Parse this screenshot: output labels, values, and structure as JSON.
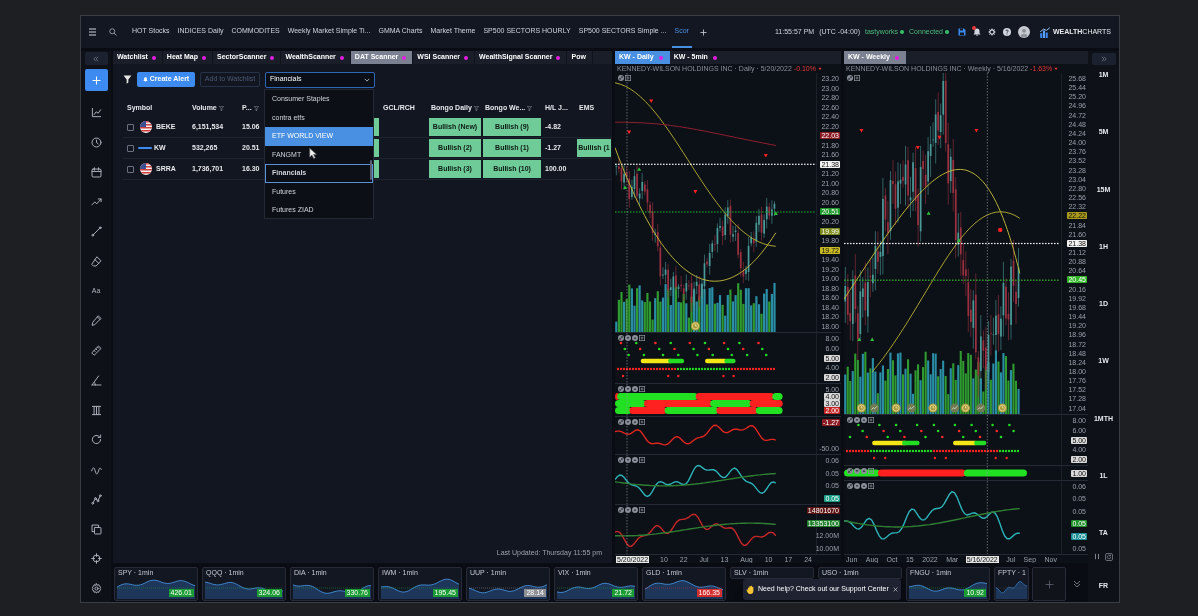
{
  "top_bar": {
    "tabs": [
      {
        "label": "HOT Stocks",
        "selected": false
      },
      {
        "label": "INDICES Daily",
        "selected": false
      },
      {
        "label": "COMMODITES",
        "selected": false
      },
      {
        "label": "Weekly Market Simple Ti...",
        "selected": false
      },
      {
        "label": "GMMA Charts",
        "selected": false
      },
      {
        "label": "Market Theme",
        "selected": false
      },
      {
        "label": "SP500 SECTORS HOURLY",
        "selected": false
      },
      {
        "label": "SP500 SECTORS Simple ...",
        "selected": false
      },
      {
        "label": "Scor",
        "selected": true
      }
    ],
    "time": "11:55:57 PM",
    "timezone": "(UTC -04:00)",
    "statuses": [
      {
        "label": "tastyworks",
        "color": "#35c46a"
      },
      {
        "label": "Connected",
        "color": "#35c46a"
      }
    ],
    "has_notifications": true,
    "logo": "**WEALTH**CHARTS"
  },
  "left_toolbar": {
    "text_tool": "Aa"
  },
  "scanner": {
    "tabs": [
      {
        "label": "Watchlist",
        "linked": true,
        "selected": false
      },
      {
        "label": "Heat Map",
        "linked": true,
        "selected": false
      },
      {
        "label": "SectorScanner",
        "linked": true,
        "selected": false
      },
      {
        "label": "WealthScanner",
        "linked": true,
        "selected": false
      },
      {
        "label": "DAT Scanner",
        "linked": true,
        "selected": true
      },
      {
        "label": "WSI Scanner",
        "linked": true,
        "selected": false
      },
      {
        "label": "WealthSignal Scanner",
        "linked": true,
        "selected": false
      },
      {
        "label": "Pow",
        "linked": false,
        "selected": false
      }
    ],
    "create_alert": "Create Alert",
    "add_to_watchlist": {
      "label": "Add to Watchlist",
      "disabled": true
    },
    "list_select": {
      "value": "Financials",
      "expanded": true,
      "options": [
        {
          "label": "Consumer Staples",
          "selected": false,
          "highlighted": false
        },
        {
          "label": "contra etfs",
          "selected": false,
          "highlighted": false
        },
        {
          "label": "ETF WORLD VIEW",
          "selected": false,
          "highlighted": true
        },
        {
          "label": "FANGMT",
          "selected": false,
          "highlighted": false
        },
        {
          "label": "Financials",
          "selected": true,
          "highlighted": false
        },
        {
          "label": "Futures",
          "selected": false,
          "highlighted": false
        },
        {
          "label": "Futures ZIAD",
          "selected": false,
          "highlighted": false
        }
      ]
    },
    "columns": [
      {
        "label": "Symbol",
        "filter": false
      },
      {
        "label": "Volume",
        "filter": true
      },
      {
        "label": "P...",
        "filter": true
      },
      {
        "label": "GCL/RCH",
        "filter": false
      },
      {
        "label": "Bongo Daily",
        "filter": true
      },
      {
        "label": "Bongo We...",
        "filter": true
      },
      {
        "label": "H/L J...",
        "filter": false
      },
      {
        "label": "EMS",
        "filter": false
      }
    ],
    "rows": [
      {
        "kind": "flag",
        "checked": false,
        "column_4": {
          "color": "#6fcb98"
        },
        "cells": [
          {
            "text": "BEKE"
          },
          {
            "text": "6,151,534"
          },
          {
            "text": "15.06"
          },
          null,
          {
            "text": "Bullish (New)",
            "color": "#6fcb98"
          },
          {
            "text": "Bullish (9)",
            "color": "#6fcb98"
          },
          {
            "text": "-4.82"
          },
          null
        ]
      },
      {
        "kind": "logo",
        "checked": false,
        "column_4": {
          "color": "#6fcb98"
        },
        "cells": [
          {
            "text": "KW"
          },
          {
            "text": "532,265"
          },
          {
            "text": "20.51"
          },
          null,
          {
            "text": "Bullish (2)",
            "color": "#6fcb98"
          },
          {
            "text": "Bullish (1)",
            "color": "#6fcb98"
          },
          {
            "text": "-1.27"
          },
          {
            "text": "Bullish (1",
            "color": "#6fcb98"
          }
        ]
      },
      {
        "kind": "flag",
        "checked": false,
        "column_4": {
          "color": "#6fcb98"
        },
        "cells": [
          {
            "text": "SRRA"
          },
          {
            "text": "1,736,701"
          },
          {
            "text": "16.30"
          },
          null,
          {
            "text": "Bullish (3)",
            "color": "#6fcb98"
          },
          {
            "text": "Bullish (10)",
            "color": "#6fcb98"
          },
          {
            "text": "100.00"
          },
          null
        ]
      }
    ],
    "last_updated": "Last Updated: Thursday 11:55 pm"
  },
  "charts": [
    {
      "active": true,
      "tabs": [
        {
          "label": "KW - Daily",
          "linked": true,
          "selected": true
        },
        {
          "label": "KW - 5min",
          "linked": true,
          "selected": false
        }
      ],
      "title": "KENNEDY-WILSON HOLDINGS INC · Daily · 5/20/2022",
      "change": "-0.10%",
      "falling": true,
      "price_axis": [
        {
          "label": "23.20"
        },
        {
          "label": "23.00"
        },
        {
          "label": "22.80"
        },
        {
          "label": "22.60"
        },
        {
          "label": "22.40"
        },
        {
          "label": "22.20"
        },
        {
          "label": "22.03",
          "color": "#8c1c24"
        },
        {
          "label": "21.80"
        },
        {
          "label": "21.60"
        },
        {
          "label": "21.38",
          "color": "#f2f2f2",
          "price_line": true
        },
        {
          "label": "21.20"
        },
        {
          "label": "21.00"
        },
        {
          "label": "20.80"
        },
        {
          "label": "20.60"
        },
        {
          "label": "20.51",
          "color": "#1f9a2c",
          "price_line": true
        },
        {
          "label": "20.20"
        },
        {
          "label": "19.99",
          "color": "#7d8a1c"
        },
        {
          "label": "19.80"
        },
        {
          "label": "19.72",
          "color": "#c9b923"
        },
        {
          "label": "19.40"
        },
        {
          "label": "19.20"
        },
        {
          "label": "19.00"
        },
        {
          "label": "18.80"
        },
        {
          "label": "18.60"
        },
        {
          "label": "18.40"
        },
        {
          "label": "18.20"
        },
        {
          "label": "18.00"
        }
      ],
      "panes": [
        {
          "kind": "dots",
          "axis": [
            {
              "label": "8.00"
            },
            {
              "label": "6.00"
            },
            {
              "label": "5.00",
              "color": "#d9d9d9"
            },
            {
              "label": "4.00"
            },
            {
              "label": "2.00",
              "color": "#d9d9d9"
            }
          ]
        },
        {
          "kind": "bands",
          "axis": [
            {
              "label": "5.00"
            },
            {
              "label": "4.00",
              "color": "#d9d9d9"
            },
            {
              "label": "3.00",
              "color": "#d9d9d9"
            },
            {
              "label": "2.00",
              "color": "#c62828"
            }
          ]
        },
        {
          "kind": "line",
          "lines": [
            {
              "color": "#e0261e"
            }
          ],
          "axis": [
            {
              "label": "-1.27",
              "color": "#8c1c24"
            },
            {
              "label": "-50.00"
            }
          ]
        },
        {
          "kind": "line",
          "lines": [
            {
              "color": "#2bb3b8"
            },
            {
              "color": "#2e7d32"
            }
          ],
          "axis": [
            {
              "label": "0.06"
            },
            {
              "label": "0.05"
            },
            {
              "label": "0.05"
            },
            {
              "label": "0.05",
              "color": "#1a9e86"
            }
          ]
        },
        {
          "kind": "line",
          "lines": [
            {
              "color": "#c62828"
            },
            {
              "color": "#2e7d32"
            }
          ],
          "axis": [
            {
              "label": "14801670",
              "color": "#5c1414"
            },
            {
              "label": "13353100",
              "color": "#1e7e2a"
            },
            {
              "label": "12.00M"
            },
            {
              "label": "10.00M"
            }
          ]
        }
      ],
      "date_axis": [
        {
          "label": "5/20/2022",
          "selected": true
        },
        {
          "label": "10",
          "selected": false
        },
        {
          "label": "22",
          "selected": false
        },
        {
          "label": "Jul",
          "selected": false
        },
        {
          "label": "13",
          "selected": false
        },
        {
          "label": "Aug",
          "selected": false
        },
        {
          "label": "10",
          "selected": false
        },
        {
          "label": "17",
          "selected": false
        },
        {
          "label": "24",
          "selected": false
        }
      ]
    },
    {
      "active": false,
      "tabs": [
        {
          "label": "KW - Weekly",
          "linked": true,
          "selected": true
        }
      ],
      "title": "KENNEDY-WILSON HOLDINGS INC · Weekly · 5/16/2022",
      "change": "-1.63%",
      "falling": true,
      "price_axis": [
        {
          "label": "25.68"
        },
        {
          "label": "25.44"
        },
        {
          "label": "25.20"
        },
        {
          "label": "24.96"
        },
        {
          "label": "24.72"
        },
        {
          "label": "24.48"
        },
        {
          "label": "24.24"
        },
        {
          "label": "24.00"
        },
        {
          "label": "23.76"
        },
        {
          "label": "23.52"
        },
        {
          "label": "23.28"
        },
        {
          "label": "23.04"
        },
        {
          "label": "22.80"
        },
        {
          "label": "22.56"
        },
        {
          "label": "22.32"
        },
        {
          "label": "22.22",
          "color": "#a99a1c"
        },
        {
          "label": "21.84"
        },
        {
          "label": "21.60"
        },
        {
          "label": "21.38",
          "color": "#f2f2f2",
          "price_line": true
        },
        {
          "label": "21.12"
        },
        {
          "label": "20.88"
        },
        {
          "label": "20.64"
        },
        {
          "label": "20.45",
          "color": "#34b52a",
          "price_line": true
        },
        {
          "label": "20.16"
        },
        {
          "label": "19.92"
        },
        {
          "label": "19.68"
        },
        {
          "label": "19.44"
        },
        {
          "label": "19.20"
        },
        {
          "label": "18.96"
        },
        {
          "label": "18.72"
        },
        {
          "label": "18.48"
        },
        {
          "label": "18.24"
        },
        {
          "label": "18.00"
        },
        {
          "label": "17.76"
        },
        {
          "label": "17.52"
        },
        {
          "label": "17.28"
        },
        {
          "label": "17.04"
        }
      ],
      "panes": [
        {
          "kind": "dots",
          "axis": [
            {
              "label": "8.00"
            },
            {
              "label": "6.00"
            },
            {
              "label": "5.00",
              "color": "#d9d9d9"
            },
            {
              "label": "4.00"
            },
            {
              "label": "2.00",
              "color": "#d9d9d9"
            }
          ]
        },
        {
          "kind": "bands",
          "axis": [
            {
              "label": "1.00",
              "color": "#d9d9d9"
            }
          ]
        },
        {
          "kind": "line",
          "lines": [
            {
              "color": "#2bb3b8"
            },
            {
              "color": "#2e7d32"
            }
          ],
          "axis": [
            {
              "label": "0.06"
            },
            {
              "label": "0.05"
            },
            {
              "label": "0.05"
            },
            {
              "label": "0.05",
              "color": "#1e8e28"
            },
            {
              "label": "0.05",
              "color": "#1a8f96"
            },
            {
              "label": "0.05"
            }
          ]
        }
      ],
      "date_axis": [
        {
          "label": "Jun",
          "selected": false
        },
        {
          "label": "Aug",
          "selected": false
        },
        {
          "label": "Oct",
          "selected": false
        },
        {
          "label": "15",
          "selected": false
        },
        {
          "label": "2022",
          "selected": false
        },
        {
          "label": "Mar",
          "selected": false
        },
        {
          "label": "5/16/2022",
          "selected": true
        },
        {
          "label": "Jul",
          "selected": false
        },
        {
          "label": "Sep",
          "selected": false
        },
        {
          "label": "Nov",
          "selected": false
        }
      ]
    }
  ],
  "timeframes": [
    "1M",
    "5M",
    "15M",
    "1H",
    "1D",
    "1W",
    "1MTH",
    "1L",
    "TA"
  ],
  "timeframe_footer": "FR",
  "tickers": [
    {
      "label": "SPY · 1min",
      "price": "426.01",
      "color": "#1c9c34"
    },
    {
      "label": "QQQ · 1min",
      "price": "324.06",
      "color": "#1c9c34"
    },
    {
      "label": "DIA · 1min",
      "price": "330.76",
      "color": "#1c9c34"
    },
    {
      "label": "IWM · 1min",
      "price": "195.45",
      "color": "#1c9c34"
    },
    {
      "label": "UUP · 1min",
      "price": "28.14",
      "color": "#8e9096"
    },
    {
      "label": "VIX · 1min",
      "price": "21.72",
      "color": "#1c9c34"
    },
    {
      "label": "GLD · 1min",
      "price": "166.35",
      "color": "#d32f2f"
    },
    {
      "label": "SLV · 1min"
    },
    {
      "label": "USO · 1min"
    },
    {
      "label": "FNGU · 1min",
      "price": "10.92",
      "color": "#1c9c34"
    },
    {
      "label": "FPTY · 1"
    }
  ],
  "help_popup": {
    "text": "Need help? Check out our Support Center"
  }
}
